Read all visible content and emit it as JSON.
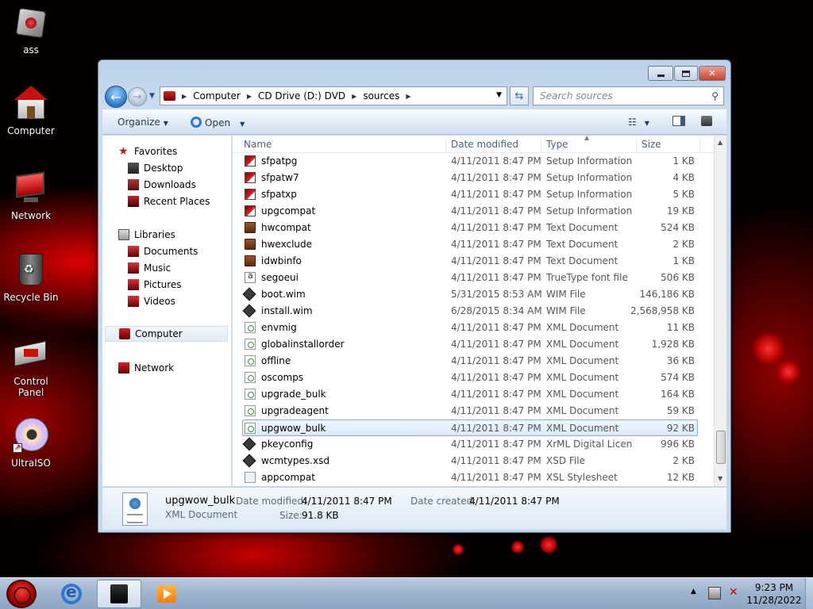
{
  "desktop": {
    "icons": [
      {
        "label": "ass"
      },
      {
        "label": "Computer"
      },
      {
        "label": "Network"
      },
      {
        "label": "Recycle Bin"
      },
      {
        "label": "Control Panel"
      },
      {
        "label": "UltraISO"
      }
    ]
  },
  "window": {
    "address": {
      "crumbs": [
        "Computer",
        "CD Drive (D:) DVD",
        "sources"
      ]
    },
    "search_placeholder": "Search sources",
    "toolbar": {
      "organize_label": "Organize",
      "open_label": "Open"
    },
    "nav": {
      "favorites": "Favorites",
      "desktop": "Desktop",
      "downloads": "Downloads",
      "recent": "Recent Places",
      "libraries": "Libraries",
      "documents": "Documents",
      "music": "Music",
      "pictures": "Pictures",
      "videos": "Videos",
      "computer": "Computer",
      "network": "Network"
    },
    "columns": {
      "name": "Name",
      "date": "Date modified",
      "type": "Type",
      "size": "Size"
    },
    "files": [
      {
        "name": "sfpatpg",
        "date": "4/11/2011 8:47 PM",
        "type": "Setup Information",
        "size": "1 KB",
        "icon": "setup"
      },
      {
        "name": "sfpatw7",
        "date": "4/11/2011 8:47 PM",
        "type": "Setup Information",
        "size": "4 KB",
        "icon": "setup"
      },
      {
        "name": "sfpatxp",
        "date": "4/11/2011 8:47 PM",
        "type": "Setup Information",
        "size": "5 KB",
        "icon": "setup"
      },
      {
        "name": "upgcompat",
        "date": "4/11/2011 8:47 PM",
        "type": "Setup Information",
        "size": "19 KB",
        "icon": "setup"
      },
      {
        "name": "hwcompat",
        "date": "4/11/2011 8:47 PM",
        "type": "Text Document",
        "size": "524 KB",
        "icon": "text"
      },
      {
        "name": "hwexclude",
        "date": "4/11/2011 8:47 PM",
        "type": "Text Document",
        "size": "2 KB",
        "icon": "text"
      },
      {
        "name": "idwbinfo",
        "date": "4/11/2011 8:47 PM",
        "type": "Text Document",
        "size": "1 KB",
        "icon": "text"
      },
      {
        "name": "segoeui",
        "date": "4/11/2011 8:47 PM",
        "type": "TrueType font file",
        "size": "506 KB",
        "icon": "font"
      },
      {
        "name": "boot.wim",
        "date": "5/31/2015 8:53 AM",
        "type": "WIM File",
        "size": "146,186 KB",
        "icon": "wim"
      },
      {
        "name": "install.wim",
        "date": "6/28/2015 8:34 AM",
        "type": "WIM File",
        "size": "2,568,958 KB",
        "icon": "wim"
      },
      {
        "name": "envmig",
        "date": "4/11/2011 8:47 PM",
        "type": "XML Document",
        "size": "11 KB",
        "icon": "xml"
      },
      {
        "name": "globalinstallorder",
        "date": "4/11/2011 8:47 PM",
        "type": "XML Document",
        "size": "1,928 KB",
        "icon": "xml"
      },
      {
        "name": "offline",
        "date": "4/11/2011 8:47 PM",
        "type": "XML Document",
        "size": "36 KB",
        "icon": "xml"
      },
      {
        "name": "oscomps",
        "date": "4/11/2011 8:47 PM",
        "type": "XML Document",
        "size": "574 KB",
        "icon": "xml"
      },
      {
        "name": "upgrade_bulk",
        "date": "4/11/2011 8:47 PM",
        "type": "XML Document",
        "size": "164 KB",
        "icon": "xml"
      },
      {
        "name": "upgradeagent",
        "date": "4/11/2011 8:47 PM",
        "type": "XML Document",
        "size": "59 KB",
        "icon": "xml"
      },
      {
        "name": "upgwow_bulk",
        "date": "4/11/2011 8:47 PM",
        "type": "XML Document",
        "size": "92 KB",
        "icon": "xml",
        "selected": true
      },
      {
        "name": "pkeyconfig",
        "date": "4/11/2011 8:47 PM",
        "type": "XrML Digital Licen...",
        "size": "996 KB",
        "icon": "wim"
      },
      {
        "name": "wcmtypes.xsd",
        "date": "4/11/2011 8:47 PM",
        "type": "XSD File",
        "size": "2 KB",
        "icon": "wim"
      },
      {
        "name": "appcompat",
        "date": "4/11/2011 8:47 PM",
        "type": "XSL Stylesheet",
        "size": "12 KB",
        "icon": "xsl"
      }
    ],
    "details": {
      "name": "upgwow_bulk",
      "type": "XML Document",
      "modified_label": "Date modified:",
      "modified_value": "4/11/2011 8:47 PM",
      "created_label": "Date created:",
      "created_value": "4/11/2011 8:47 PM",
      "size_label": "Size:",
      "size_value": "91.8 KB"
    }
  },
  "taskbar": {
    "clock_time": "9:23 PM",
    "clock_date": "11/28/2022"
  },
  "icons": {
    "back": "back-arrow-icon",
    "forward": "forward-arrow-icon",
    "refresh": "refresh-icon",
    "search": "search-icon"
  }
}
